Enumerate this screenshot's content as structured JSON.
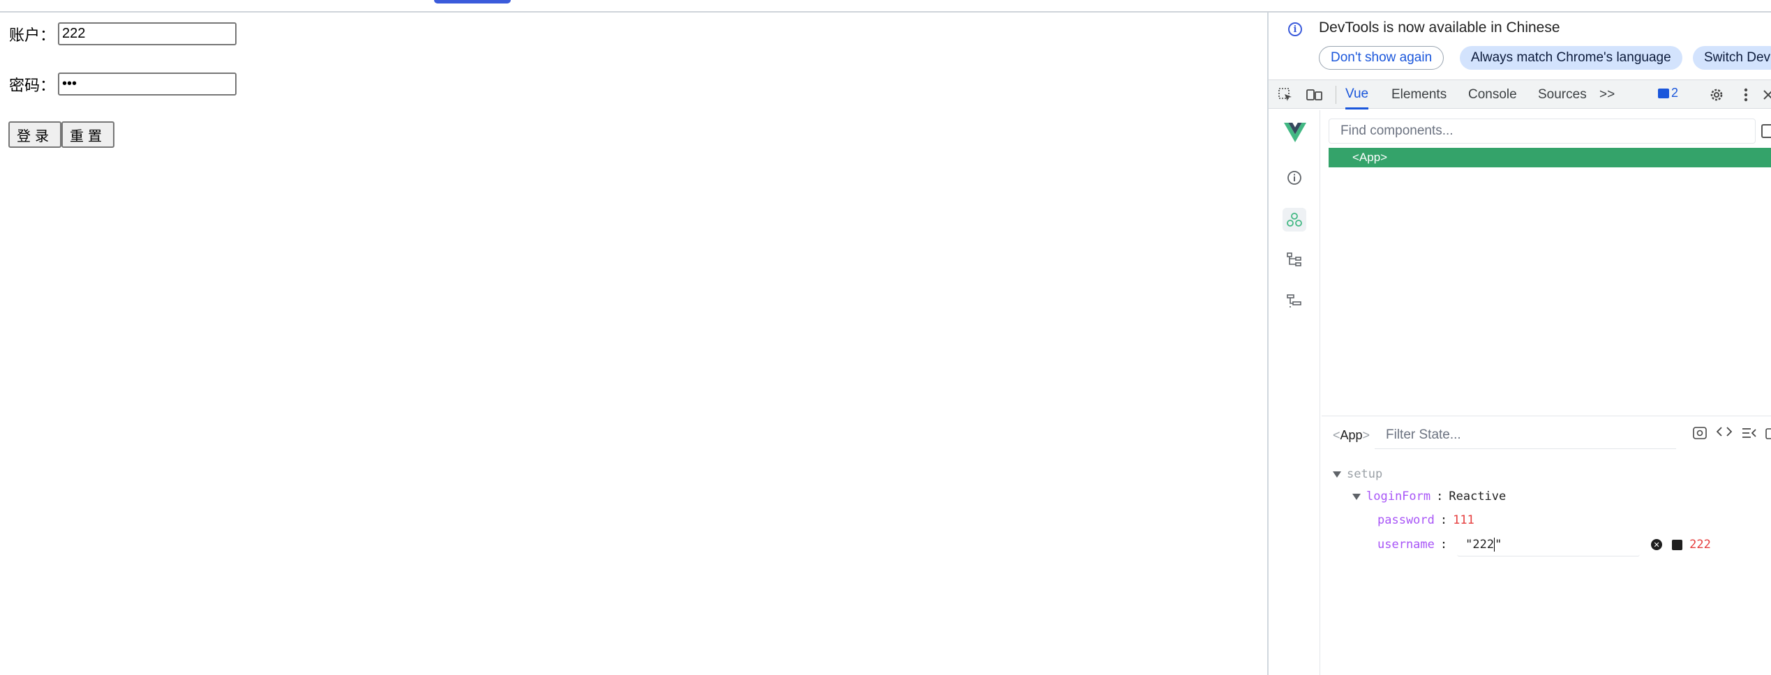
{
  "page": {
    "username_label": "账户：",
    "username_value": "222",
    "password_label": "密码：",
    "password_value": "•••",
    "login_button": "登录",
    "reset_button": "重置"
  },
  "devtools": {
    "infobar": {
      "message": "DevTools is now available in Chinese",
      "dont_show": "Don't show again",
      "always_match": "Always match Chrome's language",
      "switch": "Switch Dev"
    },
    "tabs": [
      "Vue",
      "Elements",
      "Console",
      "Sources"
    ],
    "more": ">>",
    "issues_count": "2",
    "vue": {
      "find_placeholder": "Find components...",
      "app_node": "<App>",
      "state_component": "App",
      "filter_placeholder": "Filter State...",
      "setup_label": "setup",
      "loginForm_key": "loginForm",
      "loginForm_type": "Reactive",
      "password_key": "password",
      "password_value": "111",
      "username_key": "username",
      "username_edit": "\"222",
      "username_edit_tail": "\"",
      "username_value": "222"
    }
  },
  "colors": {
    "vue_green": "#34a36a",
    "accent_blue": "#1a56db",
    "value_red": "#e53e3e",
    "key_purple": "#a855f7"
  }
}
